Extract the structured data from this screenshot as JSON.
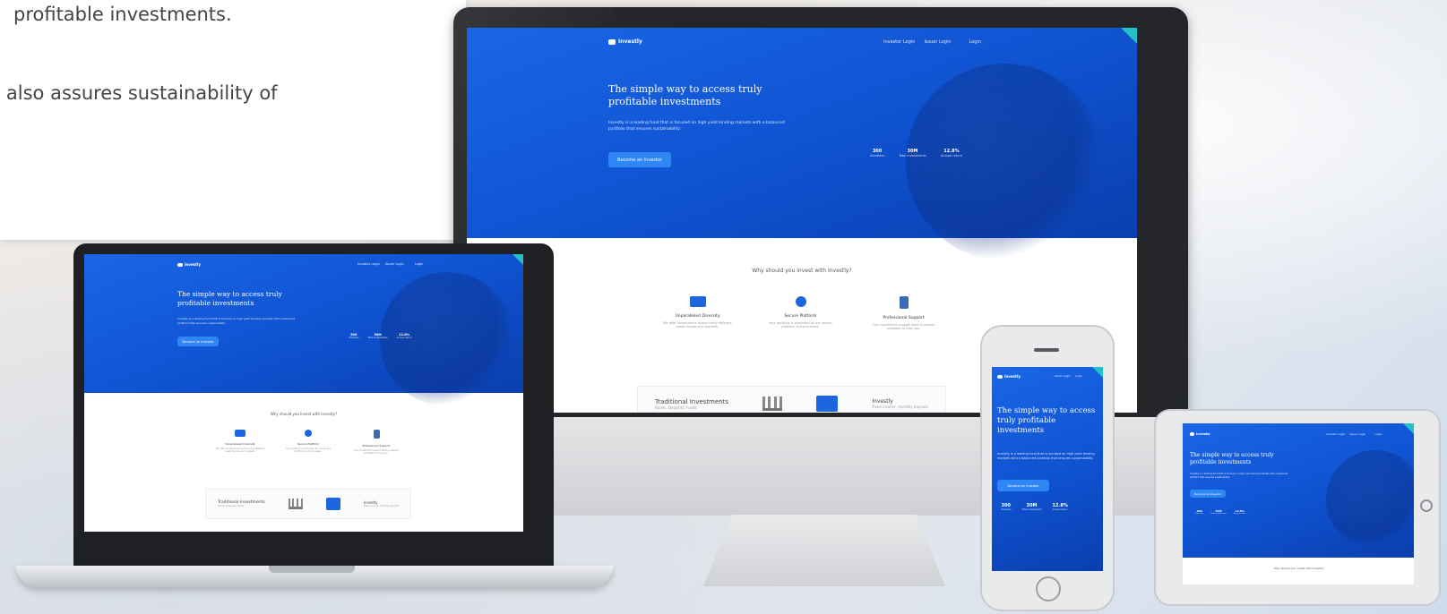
{
  "intro": {
    "line1": "profitable investments.",
    "line2": "t also assures sustainability of"
  },
  "site": {
    "brand": "Investly",
    "nav_links": [
      "Investor Login",
      "Issuer Login",
      "Login"
    ],
    "hero_title": "The simple way to access truly profitable investments",
    "hero_sub": "Investly is a leading fund that is focused on high yield lending markets with a balanced portfolio that ensures sustainability.",
    "cta": "Become an investor",
    "stats": [
      {
        "value": "300",
        "label": "Investors"
      },
      {
        "value": "30M",
        "label": "Total investments"
      },
      {
        "value": "12.8%",
        "label": "Annual return"
      }
    ],
    "why_title": "Why should you invest with Investly?",
    "features": [
      {
        "title": "Unparalleled Diversity",
        "desc": "We offer investments across many different asset classes and markets."
      },
      {
        "title": "Secure Platform",
        "desc": "Your portfolio is protected by our secure platform and processes."
      },
      {
        "title": "Professional Support",
        "desc": "Our investment support team is always available to help you."
      }
    ],
    "compare": {
      "traditional_title": "Traditional Investments",
      "traditional_desc": "Bonds, Deposits, Funds",
      "investly_title": "Investly",
      "investly_desc": "Fixed income, monthly payouts"
    }
  }
}
